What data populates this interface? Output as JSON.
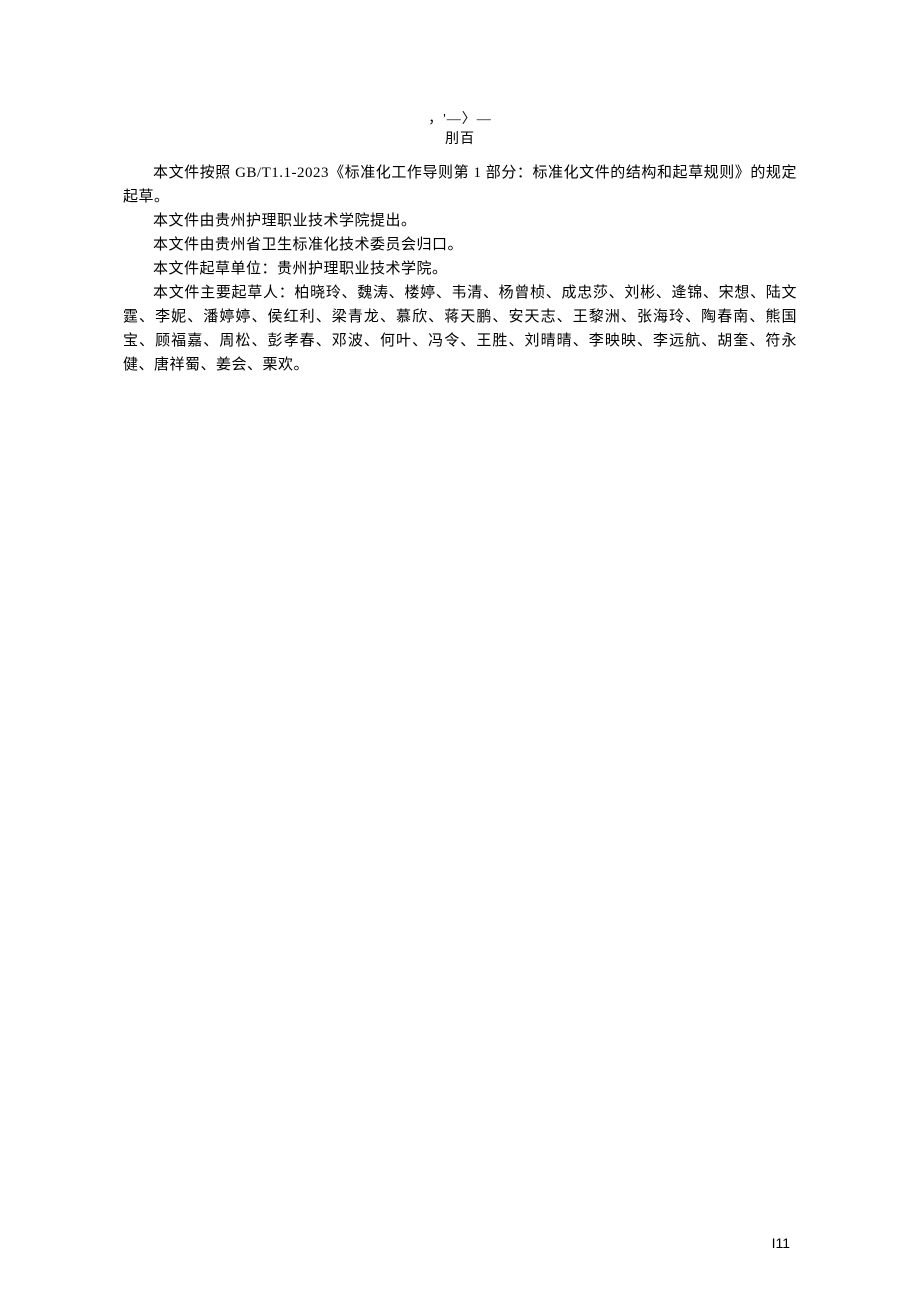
{
  "header": {
    "line1": "，'—〉—",
    "line2": "刖百"
  },
  "paragraphs": {
    "p1": "本文件按照 GB/T1.1-2023《标准化工作导则第 1 部分：标准化文件的结构和起草规则》的规定起草。",
    "p2": "本文件由贵州护理职业技术学院提出。",
    "p3": "本文件由贵州省卫生标准化技术委员会归口。",
    "p4": "本文件起草单位：贵州护理职业技术学院。",
    "p5": "本文件主要起草人：柏晓玲、魏涛、楼婷、韦清、杨曾桢、成忠莎、刘彬、逄锦、宋想、陆文霆、李妮、潘婷婷、侯红利、梁青龙、慕欣、蒋天鹏、安天志、王黎洲、张海玲、陶春南、熊国宝、顾福嘉、周松、彭孝春、邓波、何叶、冯令、王胜、刘晴晴、李映映、李远航、胡奎、符永健、唐祥蜀、姜会、栗欢。"
  },
  "pageNumber": "I11"
}
